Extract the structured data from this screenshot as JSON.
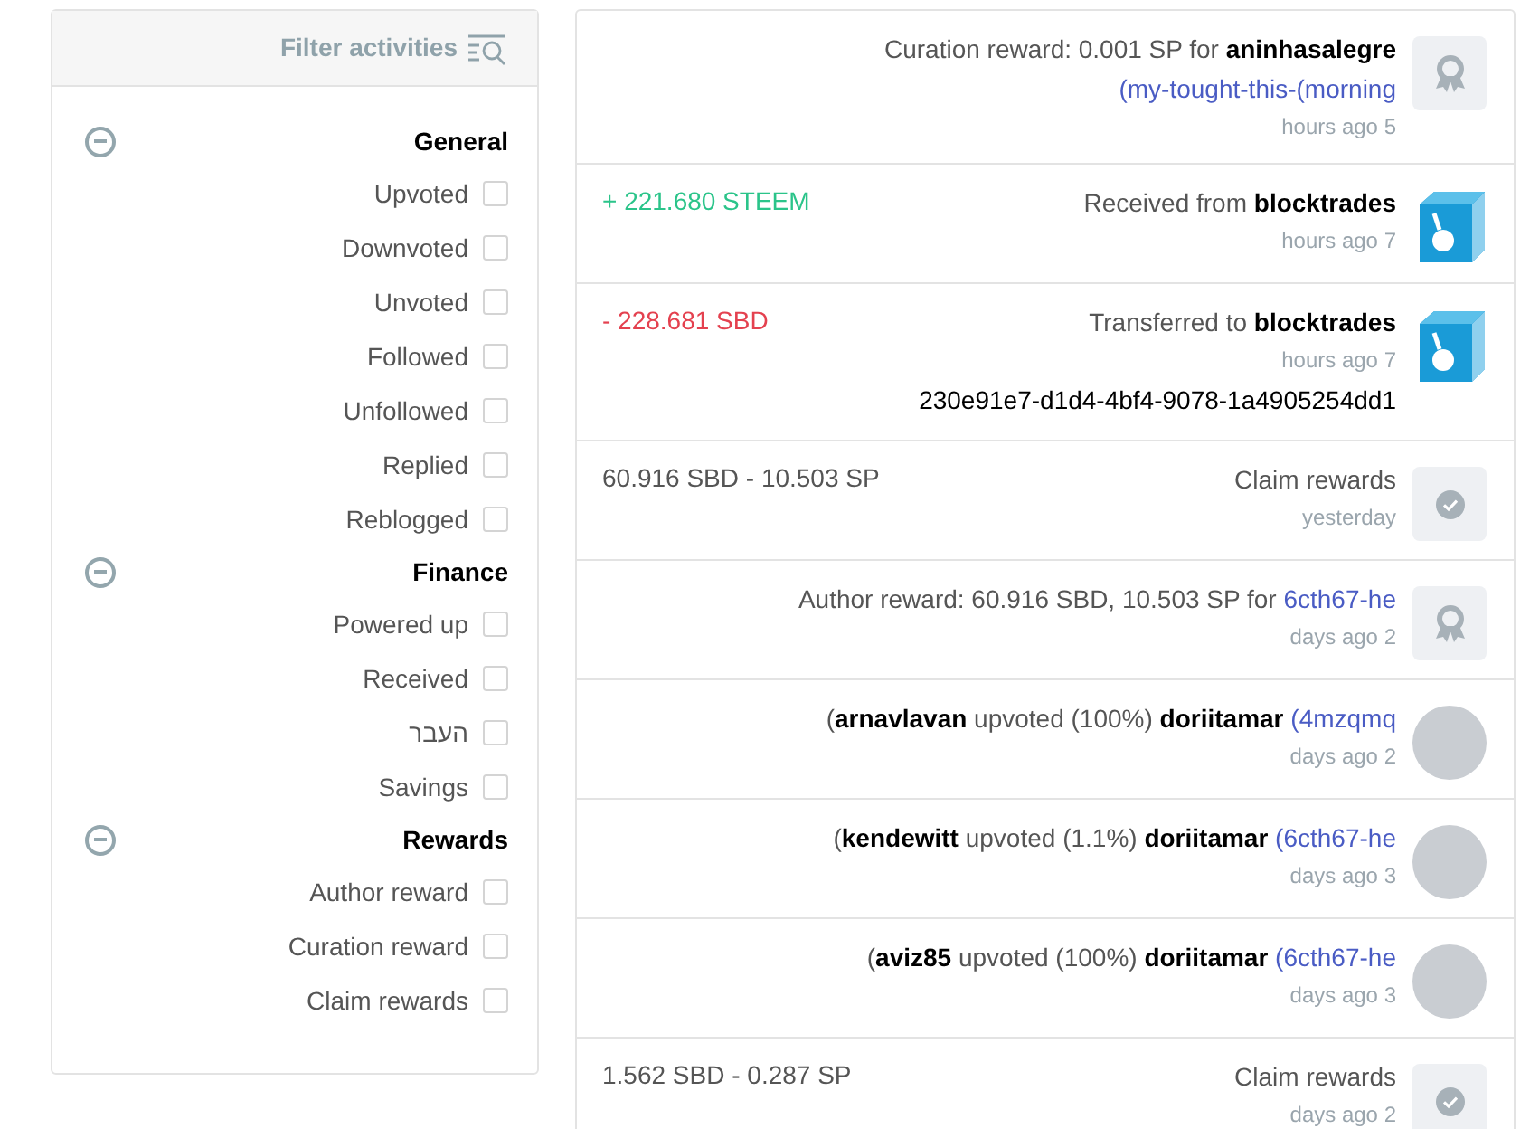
{
  "filter": {
    "title": "Filter activities",
    "groups": [
      {
        "title": "General",
        "expanded": true,
        "items": [
          {
            "label": "Upvoted",
            "checked": false
          },
          {
            "label": "Downvoted",
            "checked": false
          },
          {
            "label": "Unvoted",
            "checked": false
          },
          {
            "label": "Followed",
            "checked": false
          },
          {
            "label": "Unfollowed",
            "checked": false
          },
          {
            "label": "Replied",
            "checked": false
          },
          {
            "label": "Reblogged",
            "checked": false
          }
        ]
      },
      {
        "title": "Finance",
        "expanded": true,
        "items": [
          {
            "label": "Powered up",
            "checked": false
          },
          {
            "label": "Received",
            "checked": false
          },
          {
            "label": "העבר",
            "checked": false
          },
          {
            "label": "Savings",
            "checked": false
          }
        ]
      },
      {
        "title": "Rewards",
        "expanded": true,
        "items": [
          {
            "label": "Author reward",
            "checked": false
          },
          {
            "label": "Curation reward",
            "checked": false
          },
          {
            "label": "Claim rewards",
            "checked": false
          }
        ]
      }
    ]
  },
  "activities": [
    {
      "kind": "award",
      "parts": [
        {
          "kind": "text",
          "text": "Curation reward: 0.001 SP for "
        },
        {
          "kind": "user",
          "text": "aninhasalegre"
        },
        {
          "kind": "link",
          "text": " (my-tought-this-(morning"
        }
      ],
      "time": "hours ago 5"
    },
    {
      "kind": "logo",
      "amount": {
        "text": "+ 221.680 STEEM",
        "kind": "credit"
      },
      "parts": [
        {
          "kind": "text",
          "text": "Received from "
        },
        {
          "kind": "user",
          "text": "blocktrades"
        }
      ],
      "time": "hours ago 7"
    },
    {
      "kind": "logo",
      "amount": {
        "text": "- 228.681 SBD",
        "kind": "debit"
      },
      "parts": [
        {
          "kind": "text",
          "text": "Transferred to "
        },
        {
          "kind": "user",
          "text": "blocktrades"
        }
      ],
      "time": "hours ago 7",
      "memo": "230e91e7-d1d4-4bf4-9078-1a4905254dd1"
    },
    {
      "kind": "check",
      "amount": {
        "text": "60.916 SBD - 10.503 SP",
        "kind": "neutral"
      },
      "parts": [
        {
          "kind": "text",
          "text": "Claim rewards"
        }
      ],
      "time": "yesterday"
    },
    {
      "kind": "award",
      "parts": [
        {
          "kind": "text",
          "text": "Author reward: 60.916 SBD, 10.503 SP for "
        },
        {
          "kind": "link",
          "text": "6cth67-he"
        }
      ],
      "time": "days ago 2"
    },
    {
      "kind": "avatar",
      "parts": [
        {
          "kind": "text",
          "text": "("
        },
        {
          "kind": "user",
          "text": "arnavlavan"
        },
        {
          "kind": "text",
          "text": " upvoted (100%) "
        },
        {
          "kind": "user",
          "text": "doriitamar"
        },
        {
          "kind": "link",
          "text": " (4mzqmq"
        }
      ],
      "time": "days ago 2"
    },
    {
      "kind": "avatar",
      "parts": [
        {
          "kind": "text",
          "text": "("
        },
        {
          "kind": "user",
          "text": "kendewitt"
        },
        {
          "kind": "text",
          "text": " upvoted (1.1%) "
        },
        {
          "kind": "user",
          "text": "doriitamar"
        },
        {
          "kind": "link",
          "text": " (6cth67-he"
        }
      ],
      "time": "days ago 3"
    },
    {
      "kind": "avatar",
      "parts": [
        {
          "kind": "text",
          "text": "("
        },
        {
          "kind": "user",
          "text": "aviz85"
        },
        {
          "kind": "text",
          "text": " upvoted (100%) "
        },
        {
          "kind": "user",
          "text": "doriitamar"
        },
        {
          "kind": "link",
          "text": " (6cth67-he"
        }
      ],
      "time": "days ago 3"
    },
    {
      "kind": "check",
      "amount": {
        "text": "1.562 SBD - 0.287 SP",
        "kind": "neutral"
      },
      "parts": [
        {
          "kind": "text",
          "text": "Claim rewards"
        }
      ],
      "time": "days ago 2"
    }
  ]
}
